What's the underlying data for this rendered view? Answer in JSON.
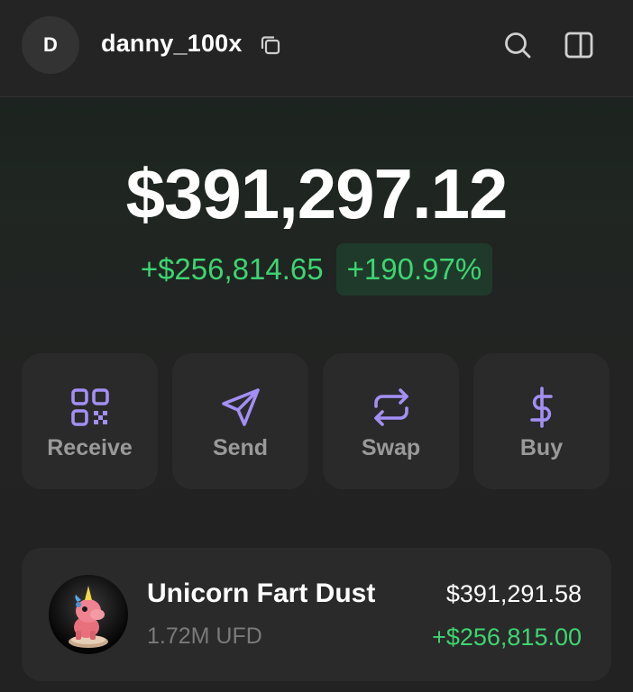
{
  "header": {
    "avatar_initial": "D",
    "username": "danny_100x",
    "icons": [
      "copy-icon",
      "search-icon",
      "side-panel-icon"
    ]
  },
  "portfolio": {
    "balance": "$391,297.12",
    "change_amount": "+$256,814.65",
    "change_percent": "+190.97%"
  },
  "actions": [
    {
      "label": "Receive",
      "icon": "qr-code-icon"
    },
    {
      "label": "Send",
      "icon": "send-icon"
    },
    {
      "label": "Swap",
      "icon": "swap-icon"
    },
    {
      "label": "Buy",
      "icon": "dollar-icon"
    }
  ],
  "tokens": [
    {
      "name": "Unicorn Fart Dust",
      "amount": "1.72M UFD",
      "value": "$391,291.58",
      "change": "+$256,815.00"
    }
  ],
  "colors": {
    "accent_purple": "#a38ff5",
    "positive_green": "#3dd571",
    "positive_bg": "#1f3a2a",
    "card_bg": "#2a2a2a"
  }
}
